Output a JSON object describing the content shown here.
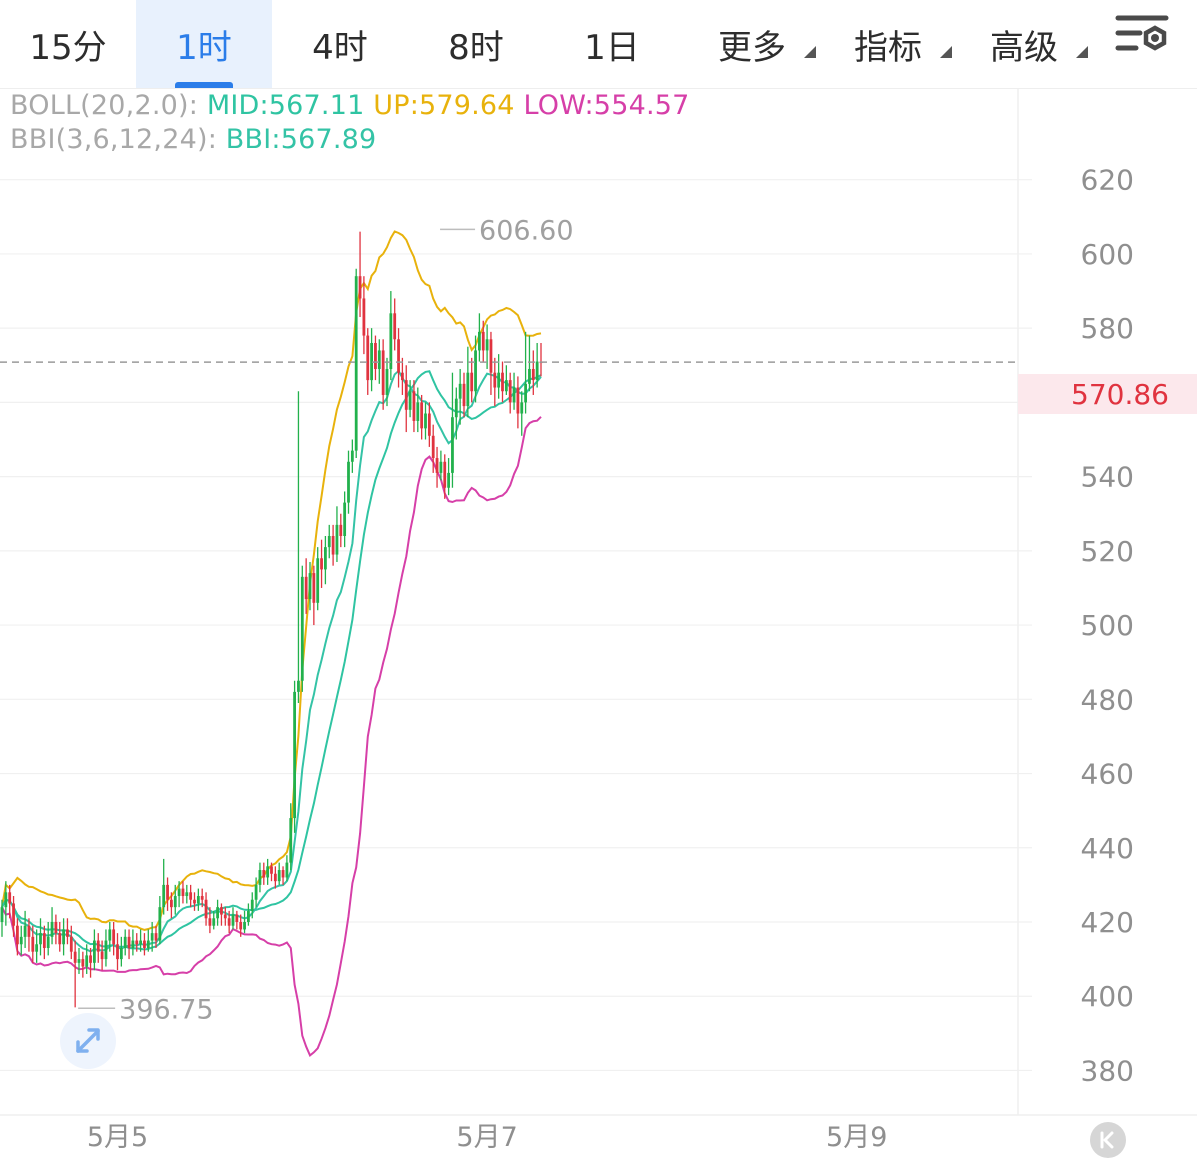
{
  "tabs": [
    {
      "label": "15分",
      "active": false
    },
    {
      "label": "1时",
      "active": true
    },
    {
      "label": "4时",
      "active": false
    },
    {
      "label": "8时",
      "active": false
    },
    {
      "label": "1日",
      "active": false
    },
    {
      "label": "更多",
      "active": false,
      "dropdown": true
    },
    {
      "label": "指标",
      "active": false,
      "dropdown": true
    },
    {
      "label": "高级",
      "active": false,
      "dropdown": true
    }
  ],
  "settings_icon": "chart-settings-icon",
  "legend": {
    "boll_name": "BOLL(20,2.0):",
    "boll_mid": "MID:567.11",
    "boll_up": "UP:579.64",
    "boll_low": "LOW:554.57",
    "bbi_name": "BBI(3,6,12,24):",
    "bbi_val": "BBI:567.89"
  },
  "colors": {
    "up": "#e0333f",
    "down": "#22b14c",
    "mid": "#2fc4a2",
    "upper": "#e8b20c",
    "lower": "#d63fa8",
    "bbi": "#34c3a6",
    "accent": "#2b7de9"
  },
  "current_price": "570.86",
  "icons": {
    "expand": "expand-arrows-icon",
    "back": "scroll-to-latest-icon"
  },
  "chart_data": {
    "type": "candlestick",
    "y_axis": {
      "ticks": [
        380,
        400,
        420,
        440,
        460,
        480,
        500,
        520,
        540,
        560,
        580,
        600,
        620
      ],
      "range": [
        368,
        628
      ],
      "position": "right"
    },
    "x_axis": {
      "labels": [
        {
          "label": "5月5",
          "index": 30
        },
        {
          "label": "5月7",
          "index": 126
        },
        {
          "label": "5月9",
          "index": 222
        }
      ]
    },
    "annotations": {
      "high": {
        "label": "606.60",
        "value": 606.6,
        "index": 113
      },
      "low": {
        "label": "396.75",
        "value": 396.75,
        "index": 19
      }
    },
    "current_price_line": 570.86,
    "candles": [
      [
        420,
        424,
        426,
        416
      ],
      [
        424,
        428,
        431,
        419
      ],
      [
        428,
        425,
        430,
        421
      ],
      [
        425,
        419,
        427,
        416
      ],
      [
        419,
        414,
        421,
        411
      ],
      [
        414,
        416,
        419,
        411
      ],
      [
        416,
        419,
        423,
        413
      ],
      [
        419,
        416,
        421,
        412
      ],
      [
        416,
        412,
        419,
        409
      ],
      [
        412,
        414,
        418,
        409
      ],
      [
        414,
        417,
        421,
        411
      ],
      [
        417,
        413,
        419,
        410
      ],
      [
        413,
        416,
        420,
        411
      ],
      [
        416,
        420,
        424,
        414
      ],
      [
        420,
        417,
        422,
        414
      ],
      [
        417,
        414,
        420,
        412
      ],
      [
        414,
        418,
        421,
        411
      ],
      [
        418,
        416,
        421,
        414
      ],
      [
        416,
        412,
        419,
        410
      ],
      [
        412,
        409,
        415,
        397
      ],
      [
        409,
        410,
        413,
        406
      ],
      [
        410,
        408,
        412,
        405
      ],
      [
        408,
        411,
        414,
        406
      ],
      [
        411,
        409,
        413,
        405
      ],
      [
        409,
        415,
        418,
        407
      ],
      [
        415,
        412,
        417,
        409
      ],
      [
        412,
        410,
        415,
        407
      ],
      [
        410,
        415,
        418,
        408
      ],
      [
        415,
        418,
        420,
        412
      ],
      [
        418,
        414,
        420,
        411
      ],
      [
        414,
        410,
        417,
        407
      ],
      [
        410,
        413,
        416,
        408
      ],
      [
        413,
        416,
        418,
        411
      ],
      [
        416,
        413,
        418,
        410
      ],
      [
        413,
        415,
        418,
        411
      ],
      [
        415,
        414,
        417,
        412
      ],
      [
        414,
        415,
        418,
        412
      ],
      [
        415,
        413,
        417,
        411
      ],
      [
        413,
        415,
        418,
        412
      ],
      [
        415,
        417,
        420,
        412
      ],
      [
        417,
        415,
        419,
        413
      ],
      [
        415,
        424,
        427,
        414
      ],
      [
        424,
        430,
        437,
        422
      ],
      [
        430,
        426,
        432,
        423
      ],
      [
        426,
        424,
        428,
        421
      ],
      [
        424,
        427,
        430,
        422
      ],
      [
        427,
        429,
        431,
        424
      ],
      [
        429,
        427,
        431,
        425
      ],
      [
        427,
        428,
        430,
        425
      ],
      [
        428,
        426,
        430,
        424
      ],
      [
        426,
        425,
        428,
        423
      ],
      [
        425,
        427,
        429,
        423
      ],
      [
        427,
        426,
        429,
        424
      ],
      [
        426,
        421,
        428,
        419
      ],
      [
        421,
        419,
        424,
        417
      ],
      [
        419,
        421,
        423,
        418
      ],
      [
        421,
        424,
        426,
        419
      ],
      [
        424,
        422,
        425,
        419
      ],
      [
        422,
        421,
        424,
        419
      ],
      [
        421,
        419,
        423,
        417
      ],
      [
        419,
        422,
        424,
        418
      ],
      [
        422,
        420,
        423,
        418
      ],
      [
        420,
        418,
        422,
        416
      ],
      [
        418,
        420,
        423,
        417
      ],
      [
        420,
        423,
        425,
        419
      ],
      [
        423,
        426,
        428,
        421
      ],
      [
        426,
        430,
        432,
        424
      ],
      [
        430,
        434,
        436,
        428
      ],
      [
        434,
        432,
        436,
        430
      ],
      [
        432,
        435,
        437,
        430
      ],
      [
        435,
        433,
        436,
        431
      ],
      [
        433,
        431,
        435,
        429
      ],
      [
        431,
        434,
        436,
        430
      ],
      [
        434,
        432,
        435,
        430
      ],
      [
        432,
        436,
        438,
        431
      ],
      [
        436,
        448,
        452,
        434
      ],
      [
        448,
        482,
        485,
        444
      ],
      [
        482,
        485,
        563,
        479
      ],
      [
        485,
        513,
        516,
        482
      ],
      [
        513,
        507,
        518,
        503
      ],
      [
        507,
        514,
        517,
        504
      ],
      [
        514,
        506,
        516,
        500
      ],
      [
        506,
        518,
        521,
        504
      ],
      [
        518,
        515,
        523,
        510
      ],
      [
        515,
        521,
        524,
        511
      ],
      [
        521,
        524,
        527,
        518
      ],
      [
        524,
        519,
        527,
        516
      ],
      [
        519,
        527,
        532,
        517
      ],
      [
        527,
        524,
        530,
        521
      ],
      [
        524,
        533,
        536,
        521
      ],
      [
        533,
        544,
        547,
        530
      ],
      [
        544,
        547,
        550,
        541
      ],
      [
        547,
        594,
        596,
        545
      ],
      [
        594,
        588,
        606,
        583
      ],
      [
        588,
        578,
        594,
        573
      ],
      [
        578,
        566,
        580,
        562
      ],
      [
        566,
        576,
        580,
        563
      ],
      [
        576,
        569,
        578,
        566
      ],
      [
        569,
        574,
        577,
        565
      ],
      [
        574,
        562,
        577,
        558
      ],
      [
        562,
        569,
        572,
        559
      ],
      [
        569,
        584,
        590,
        566
      ],
      [
        584,
        577,
        588,
        574
      ],
      [
        577,
        568,
        580,
        564
      ],
      [
        568,
        566,
        572,
        562
      ],
      [
        566,
        558,
        570,
        552
      ],
      [
        558,
        563,
        566,
        556
      ],
      [
        563,
        555,
        566,
        552
      ],
      [
        555,
        560,
        564,
        552
      ],
      [
        560,
        553,
        562,
        550
      ],
      [
        553,
        557,
        560,
        550
      ],
      [
        557,
        551,
        560,
        548
      ],
      [
        551,
        545,
        554,
        541
      ],
      [
        545,
        541,
        548,
        537
      ],
      [
        541,
        544,
        547,
        539
      ],
      [
        544,
        537,
        546,
        534
      ],
      [
        537,
        541,
        545,
        535
      ],
      [
        541,
        556,
        568,
        537
      ],
      [
        556,
        561,
        564,
        550
      ],
      [
        561,
        565,
        569,
        554
      ],
      [
        565,
        559,
        568,
        556
      ],
      [
        559,
        568,
        575,
        556
      ],
      [
        568,
        563,
        572,
        560
      ],
      [
        563,
        574,
        578,
        560
      ],
      [
        574,
        579,
        584,
        571
      ],
      [
        579,
        574,
        582,
        571
      ],
      [
        574,
        577,
        581,
        569
      ],
      [
        577,
        568,
        579,
        562
      ],
      [
        568,
        564,
        572,
        559
      ],
      [
        564,
        568,
        573,
        561
      ],
      [
        568,
        563,
        571,
        560
      ],
      [
        563,
        566,
        570,
        562
      ],
      [
        566,
        560,
        568,
        557
      ],
      [
        560,
        564,
        568,
        558
      ],
      [
        564,
        557,
        567,
        553
      ],
      [
        557,
        560,
        563,
        551
      ],
      [
        560,
        565,
        579,
        557
      ],
      [
        565,
        569,
        578,
        563
      ],
      [
        569,
        566,
        574,
        562
      ],
      [
        566,
        571,
        576,
        564
      ],
      [
        571,
        570.86,
        576,
        567
      ]
    ],
    "series": [
      {
        "name": "MID",
        "key": "mid"
      },
      {
        "name": "UP",
        "key": "up"
      },
      {
        "name": "LOW",
        "key": "low"
      },
      {
        "name": "BBI",
        "key": "bbi"
      }
    ]
  }
}
